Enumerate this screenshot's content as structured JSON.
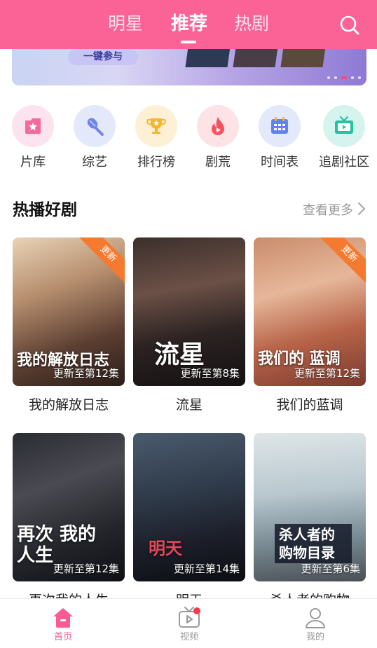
{
  "header": {
    "tabs": [
      {
        "label": "明星",
        "active": false
      },
      {
        "label": "推荐",
        "active": true
      },
      {
        "label": "热剧",
        "active": false
      }
    ],
    "search_icon": "search-icon",
    "background": "#fb6396"
  },
  "banner": {
    "join_label": "一键参与",
    "page_count": 5,
    "active_page": 3
  },
  "categories": [
    {
      "label": "片库",
      "icon": "star-box-icon",
      "bg": "#fde3ee",
      "color": "#f66a9b"
    },
    {
      "label": "综艺",
      "icon": "microphone-icon",
      "bg": "#e3e8fb",
      "color": "#6f84e8"
    },
    {
      "label": "排行榜",
      "icon": "trophy-icon",
      "bg": "#fdf0d5",
      "color": "#f6b62b"
    },
    {
      "label": "剧荒",
      "icon": "flame-icon",
      "bg": "#fde3e6",
      "color": "#f5535f"
    },
    {
      "label": "时间表",
      "icon": "calendar-icon",
      "bg": "#e3e8fb",
      "color": "#5e84ef"
    },
    {
      "label": "追剧社区",
      "icon": "tv-icon",
      "bg": "#d6f4ee",
      "color": "#25c2a0"
    }
  ],
  "section": {
    "title": "热播好剧",
    "more_label": "查看更多"
  },
  "dramas": [
    {
      "title": "我的解放日志",
      "episode_label": "更新至第12集",
      "poster_text": "我的解放日志",
      "badge": "更新"
    },
    {
      "title": "流星",
      "episode_label": "更新至第8集",
      "poster_text": "流星",
      "badge": ""
    },
    {
      "title": "我们的蓝调",
      "episode_label": "更新至第12集",
      "poster_text": "我们的 蓝调",
      "badge": "更新"
    },
    {
      "title": "再次我的人生",
      "episode_label": "更新至第12集",
      "poster_text": "再次 我的人生",
      "badge": ""
    },
    {
      "title": "明天",
      "episode_label": "更新至第14集",
      "poster_text": "明天",
      "badge": ""
    },
    {
      "title": "杀人者的购物",
      "episode_label": "更新至第6集",
      "poster_text": "杀人者的 购物目录",
      "badge": ""
    }
  ],
  "bottom_nav": [
    {
      "label": "首页",
      "icon": "home-icon",
      "active": true
    },
    {
      "label": "视频",
      "icon": "video-tv-icon",
      "active": false,
      "has_dot": true
    },
    {
      "label": "我的",
      "icon": "user-icon",
      "active": false
    }
  ],
  "colors": {
    "accent": "#fb6396",
    "ribbon": "#f47a2f",
    "notify_dot": "#f23a4f"
  }
}
